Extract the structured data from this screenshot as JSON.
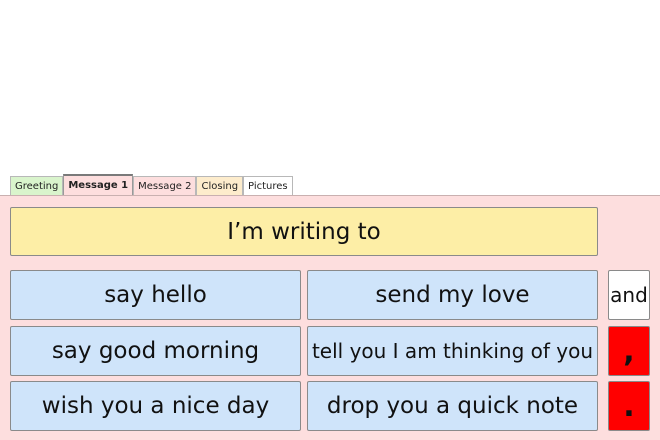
{
  "tabs": [
    {
      "label": "Greeting",
      "color": "#d9f4cc"
    },
    {
      "label": "Message 1",
      "color": "#fddede"
    },
    {
      "label": "Message 2",
      "color": "#fddede"
    },
    {
      "label": "Closing",
      "color": "#fdeccc"
    },
    {
      "label": "Pictures",
      "color": "#ffffff"
    }
  ],
  "active_tab": "Message 1",
  "header_phrase": "I’m writing to",
  "phrases": [
    "say hello",
    "send my love",
    "say good morning",
    "tell you I am thinking of you",
    "wish you a nice day",
    "drop you a quick note"
  ],
  "words": {
    "and": "and",
    "comma": ",",
    "period": "."
  },
  "colors": {
    "panel": "#fddede",
    "header_cell": "#fdeea6",
    "phrase_cell": "#cfe4fa",
    "punctuation_cell": "#ff0000"
  }
}
